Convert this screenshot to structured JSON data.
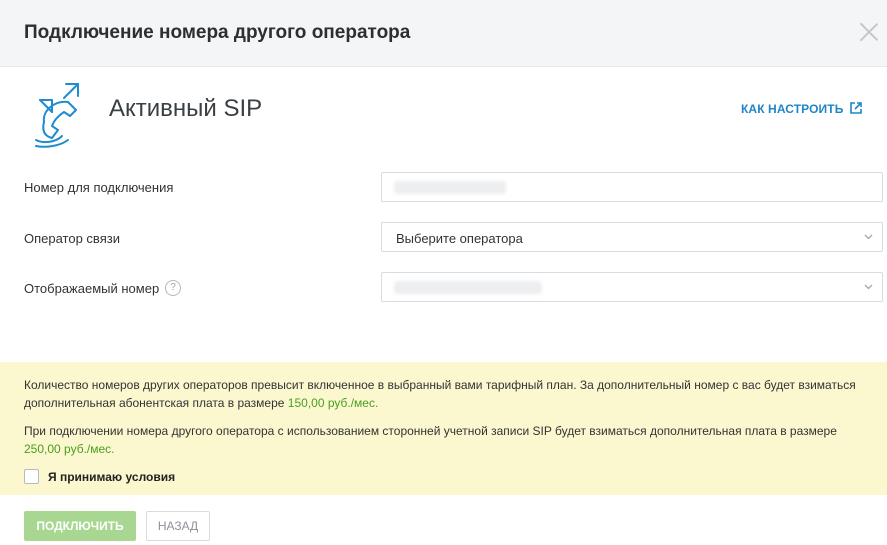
{
  "dialog": {
    "title": "Подключение номера другого оператора"
  },
  "service": {
    "name": "Активный SIP",
    "howto_label": "КАК НАСТРОИТЬ",
    "icon": "sip-phone-icon"
  },
  "form": {
    "phone_number": {
      "label": "Номер для подключения",
      "value": ""
    },
    "operator": {
      "label": "Оператор связи",
      "value": "Выберите оператора"
    },
    "display_number": {
      "label": "Отображаемый номер",
      "help_glyph": "?",
      "value": ""
    }
  },
  "notice": {
    "text1": "Количество номеров других операторов превысит включенное в выбранный вами тарифный план. За дополнительный номер с вас будет взиматься дополнительная абонентская плата в размере",
    "price1": "150,00 руб./мес.",
    "text2": "При подключении номера другого оператора с использованием сторонней учетной записи SIP будет взиматься дополнительная плата в размере",
    "price2": "250,00 руб./мес.",
    "agree_label": "Я принимаю условия",
    "agree_checked": false
  },
  "footer": {
    "connect_label": "подключить",
    "back_label": "назад"
  },
  "colors": {
    "accent": "#1e86c7",
    "price": "#4a9f1e",
    "notice_bg": "#fbf7cf",
    "connect_disabled": "#a8d792"
  }
}
